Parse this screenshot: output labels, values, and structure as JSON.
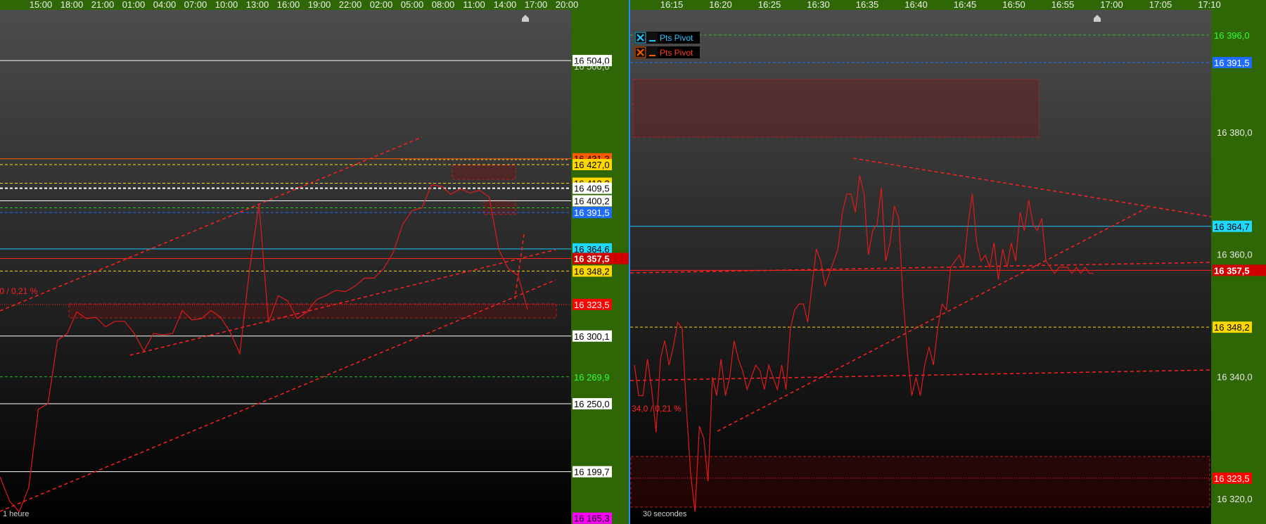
{
  "theme": {
    "axis_green": "#2f6606",
    "panel_top": "#4a4a4a",
    "panel_bottom": "#000000",
    "price_line": "#e01b1b",
    "divider": "#1e90ff"
  },
  "chart_data": [
    {
      "type": "line",
      "name": "left-panel",
      "timeframe_label": "1 heure",
      "time_labels": [
        "15:00",
        "18:00",
        "21:00",
        "01:00",
        "04:00",
        "07:00",
        "10:00",
        "13:00",
        "16:00",
        "19:00",
        "22:00",
        "02:00",
        "05:00",
        "08:00",
        "11:00",
        "14:00",
        "17:00",
        "20:00"
      ],
      "ylim": [
        16161,
        16541
      ],
      "price_series": [
        16196,
        16178,
        16170,
        16188,
        16246,
        16250,
        16297,
        16302,
        16318,
        16313,
        16314,
        16307,
        16311,
        16311,
        16302,
        16289,
        16302,
        16301,
        16302,
        16319,
        16312,
        16313,
        16319,
        16314,
        16303,
        16287,
        16348,
        16398,
        16310,
        16330,
        16326,
        16313,
        16318,
        16327,
        16330,
        16334,
        16333,
        16337,
        16343,
        16343,
        16350,
        16362,
        16383,
        16393,
        16395,
        16412,
        16411,
        16405,
        16409,
        16406,
        16408,
        16403,
        16364,
        16350,
        16345,
        16320
      ],
      "horizontal_levels": [
        {
          "value": 16504.0,
          "label": "16 504,0",
          "color": "#ffffff",
          "style": "solid",
          "tag_bg": "#ffffff",
          "tag_fg": "#000000"
        },
        {
          "value": 16500.0,
          "label": "16 500,0",
          "color": "#ffffff",
          "style": "none",
          "tag_bg": "none",
          "tag_fg": "#cfd8cf"
        },
        {
          "value": 16431.3,
          "label": "16 431,3",
          "color": "#ff5a00",
          "style": "solid",
          "tag_bg": "#ff5a00",
          "tag_fg": "#000000"
        },
        {
          "value": 16427.0,
          "label": "16 427,0",
          "color": "#ffd700",
          "style": "dashed",
          "tag_bg": "#ffd700",
          "tag_fg": "#000000"
        },
        {
          "value": 16413.2,
          "label": "16 413,2",
          "color": "#ffd700",
          "style": "dashed",
          "tag_bg": "#ffd700",
          "tag_fg": "#000000"
        },
        {
          "value": 16409.5,
          "label": "16 409,5",
          "color": "#ffffff",
          "style": "dashed",
          "tag_bg": "#ffffff",
          "tag_fg": "#000000"
        },
        {
          "value": 16400.2,
          "label": "16 400,2",
          "color": "#ffffff",
          "style": "solid",
          "tag_bg": "#ffffff",
          "tag_fg": "#000000"
        },
        {
          "value": 16395.0,
          "label": "",
          "color": "#22c022",
          "style": "dashed",
          "tag_bg": "none",
          "tag_fg": "none"
        },
        {
          "value": 16391.5,
          "label": "16 391,5",
          "color": "#1e6cff",
          "style": "dashed",
          "tag_bg": "#1e6cff",
          "tag_fg": "#ffffff"
        },
        {
          "value": 16364.6,
          "label": "16 364,6",
          "color": "#1ec8ff",
          "style": "solid",
          "tag_bg": "#1ed8ff",
          "tag_fg": "#000000"
        },
        {
          "value": 16357.5,
          "label": "16 357,5",
          "color": "#ff2020",
          "style": "solid",
          "tag_bg": "#d00000",
          "tag_fg": "#ffffff"
        },
        {
          "value": 16348.2,
          "label": "16 348,2",
          "color": "#ffd700",
          "style": "dashed",
          "tag_bg": "#ffd700",
          "tag_fg": "#000000"
        },
        {
          "value": 16323.5,
          "label": "16 323,5",
          "color": "#ff2020",
          "style": "dotted",
          "tag_bg": "#ff0000",
          "tag_fg": "#ffffff"
        },
        {
          "value": 16300.1,
          "label": "16 300,1",
          "color": "#ffffff",
          "style": "solid",
          "tag_bg": "#ffffff",
          "tag_fg": "#000000"
        },
        {
          "value": 16269.9,
          "label": "16 269,9",
          "color": "#22c022",
          "style": "dashed",
          "tag_bg": "none",
          "tag_fg": "#33ff33"
        },
        {
          "value": 16250.0,
          "label": "16 250,0",
          "color": "#ffffff",
          "style": "solid",
          "tag_bg": "#ffffff",
          "tag_fg": "#000000"
        },
        {
          "value": 16199.7,
          "label": "16 199,7",
          "color": "#ffffff",
          "style": "solid",
          "tag_bg": "#ffffff",
          "tag_fg": "#000000"
        },
        {
          "value": 16165.3,
          "label": "16 165,3",
          "color": "#ff00ff",
          "style": "none",
          "tag_bg": "#ff00ff",
          "tag_fg": "#000000"
        }
      ],
      "annotation": ",0 / 0,21 %"
    },
    {
      "type": "line",
      "name": "right-panel",
      "timeframe_label": "30 secondes",
      "time_labels": [
        "16:15",
        "16:20",
        "16:25",
        "16:30",
        "16:35",
        "16:40",
        "16:45",
        "16:50",
        "16:55",
        "17:00",
        "17:05",
        "17:10"
      ],
      "ylim": [
        16316,
        16400
      ],
      "price_series": [
        16342,
        16337,
        16337,
        16343,
        16338,
        16331,
        16343,
        16346,
        16342,
        16345,
        16349,
        16348,
        16335,
        16324,
        16318,
        16332,
        16330,
        16323,
        16340,
        16337,
        16343,
        16337,
        16340,
        16346,
        16343,
        16341,
        16338,
        16340,
        16342,
        16341,
        16338,
        16342,
        16340,
        16338,
        16342,
        16338,
        16348,
        16351,
        16352,
        16352,
        16349,
        16355,
        16361,
        16359,
        16355,
        16357,
        16359,
        16361,
        16367,
        16370,
        16370,
        16367,
        16373,
        16370,
        16360,
        16364,
        16365,
        16371,
        16359,
        16362,
        16368,
        16366,
        16353,
        16344,
        16337,
        16340,
        16337,
        16342,
        16345,
        16342,
        16348,
        16352,
        16351,
        16358,
        16359,
        16360,
        16358,
        16365,
        16370,
        16362,
        16359,
        16360,
        16358,
        16362,
        16356,
        16361,
        16358,
        16362,
        16359,
        16367,
        16364,
        16369,
        16365,
        16364,
        16366,
        16359,
        16358,
        16357,
        16358,
        16358,
        16358,
        16357,
        16358,
        16357,
        16358,
        16357,
        16357
      ],
      "horizontal_levels": [
        {
          "value": 16396.0,
          "label": "16 396,0",
          "color": "#22c022",
          "style": "dashed",
          "tag_bg": "none",
          "tag_fg": "#33ff33"
        },
        {
          "value": 16391.5,
          "label": "16 391,5",
          "color": "#1e6cff",
          "style": "dashed",
          "tag_bg": "#1e6cff",
          "tag_fg": "#ffffff"
        },
        {
          "value": 16364.7,
          "label": "16 364,7",
          "color": "#1ec8ff",
          "style": "solid",
          "tag_bg": "#1ed8ff",
          "tag_fg": "#000000"
        },
        {
          "value": 16357.5,
          "label": "16 357,5",
          "color": "#ff2020",
          "style": "solid",
          "tag_bg": "#d00000",
          "tag_fg": "#ffffff"
        },
        {
          "value": 16348.2,
          "label": "16 348,2",
          "color": "#ffd700",
          "style": "dashed",
          "tag_bg": "#ffd700",
          "tag_fg": "#000000"
        },
        {
          "value": 16323.5,
          "label": "16 323,5",
          "color": "#ff2020",
          "style": "dotted",
          "tag_bg": "#ff0000",
          "tag_fg": "#ffffff"
        }
      ],
      "axis_ticks": [
        "16 380,0",
        "16 360,0",
        "16 340,0",
        "16 320,0"
      ],
      "axis_tick_values": [
        16380,
        16360,
        16340,
        16320
      ],
      "annotation": "34,0 / 0,21 %",
      "legend": [
        {
          "label": "Pts Pivot",
          "color": "#1ec8ff",
          "close_color": "#1ec8ff"
        },
        {
          "label": "Pts Pivot",
          "color": "#ff3b1f",
          "close_color": "#ff5a00"
        }
      ]
    }
  ]
}
